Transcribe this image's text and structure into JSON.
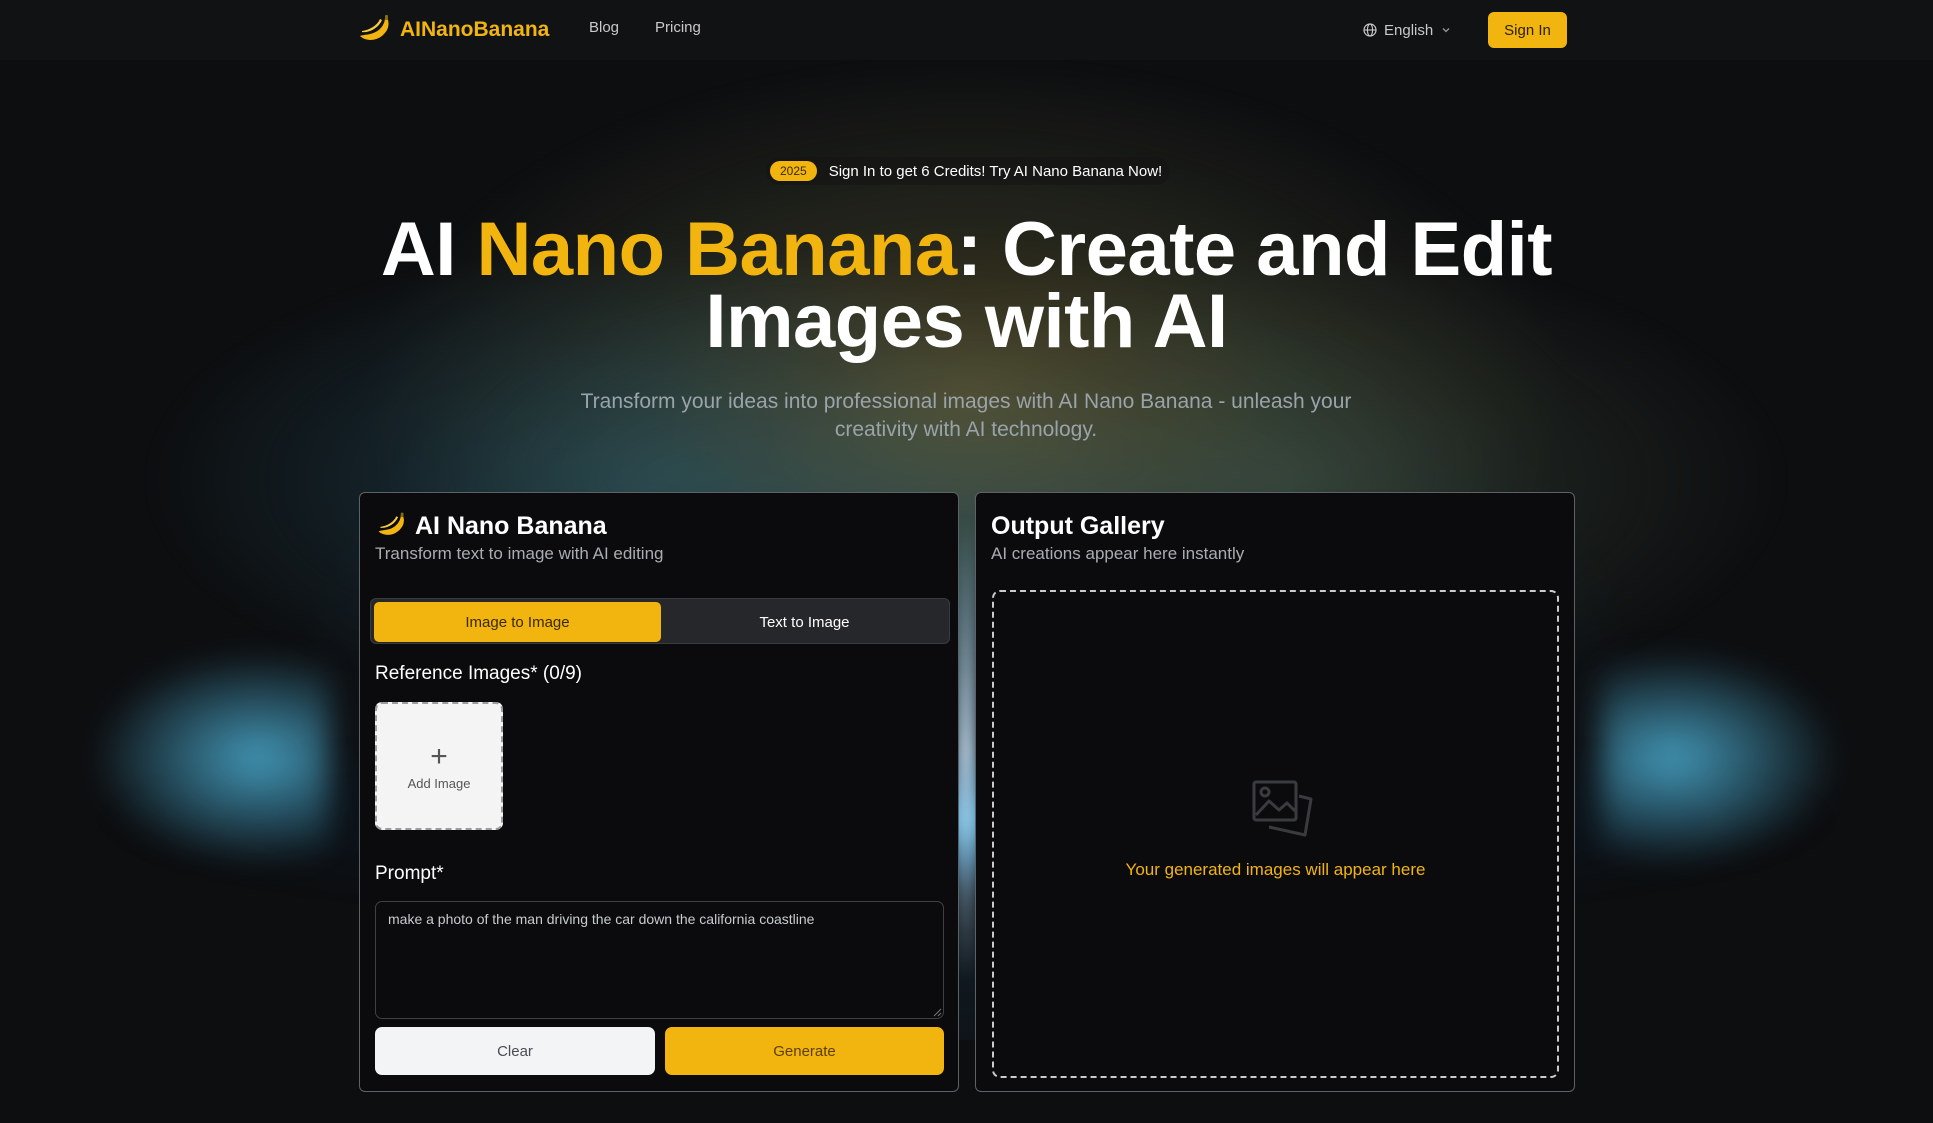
{
  "header": {
    "brand": "AINanoBanana",
    "nav": [
      {
        "label": "Blog"
      },
      {
        "label": "Pricing"
      }
    ],
    "language": "English",
    "sign_in": "Sign In"
  },
  "hero": {
    "badge": "2025",
    "promo": "Sign In to get 6 Credits! Try AI Nano Banana Now!",
    "title_prefix": "AI ",
    "title_accent": "Nano Banana",
    "title_suffix": ": Create and Edit Images with AI",
    "subtitle": "Transform your ideas into professional images with AI Nano Banana - unleash your creativity with AI technology."
  },
  "editor": {
    "title": "AI Nano Banana",
    "subtitle": "Transform text to image with AI editing",
    "tabs": [
      {
        "label": "Image to Image",
        "active": true
      },
      {
        "label": "Text to Image",
        "active": false
      }
    ],
    "reference_label": "Reference Images* (0/9)",
    "add_image": "Add Image",
    "prompt_label": "Prompt*",
    "prompt_value": "make a photo of the man driving the car down the california coastline",
    "clear": "Clear",
    "generate": "Generate"
  },
  "gallery": {
    "title": "Output Gallery",
    "subtitle": "AI creations appear here instantly",
    "empty_text": "Your generated images will appear here"
  },
  "colors": {
    "accent": "#f2b40f",
    "background": "#0d0e10",
    "panel": "#0b0b0d"
  },
  "icons": {
    "brand": "banana-icon",
    "language": "globe-icon",
    "dropdown": "chevron-down-icon",
    "add": "plus-icon",
    "gallery": "image-icon"
  }
}
